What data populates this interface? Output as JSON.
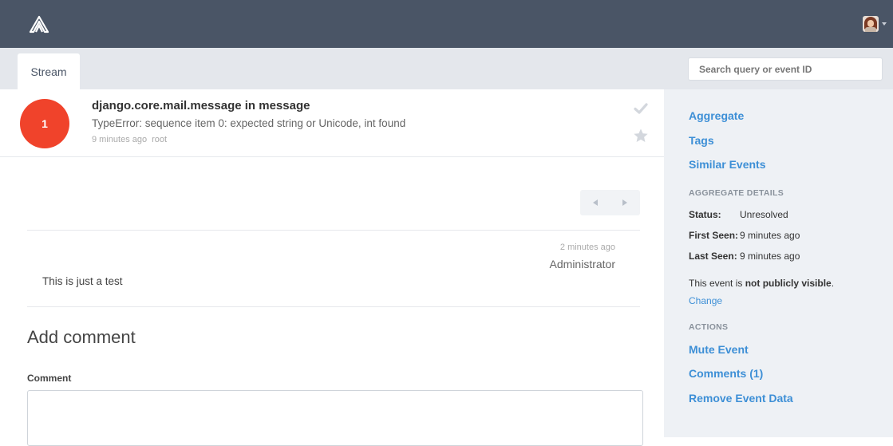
{
  "topbar": {
    "logo_icon": "sentry-logo-icon",
    "avatar_icon": "user-avatar-icon"
  },
  "tabs": [
    {
      "label": "Stream"
    }
  ],
  "search": {
    "placeholder": "Search query or event ID",
    "value": ""
  },
  "event": {
    "count": "1",
    "title": "django.core.mail.message in message",
    "message": "TypeError: sequence item 0: expected string or Unicode, int found",
    "time_ago": "9 minutes ago",
    "user": "root",
    "badge_color": "#f0432b"
  },
  "comment": {
    "time": "2 minutes ago",
    "author": "Administrator",
    "text": "This is just a test"
  },
  "add_comment": {
    "title": "Add comment",
    "field_label": "Comment",
    "field_value": ""
  },
  "sidebar": {
    "nav": [
      "Aggregate",
      "Tags",
      "Similar Events"
    ],
    "details_heading": "AGGREGATE DETAILS",
    "details": [
      {
        "key": "Status:",
        "value": "Unresolved"
      },
      {
        "key": "First Seen:",
        "value": "9 minutes ago"
      },
      {
        "key": "Last Seen:",
        "value": "9 minutes ago"
      }
    ],
    "visibility_prefix": "This event is ",
    "visibility_strong": "not publicly visible",
    "visibility_suffix": ".",
    "change_label": "Change",
    "actions_heading": "ACTIONS",
    "actions": [
      "Mute Event",
      "Comments (1)",
      "Remove Event Data"
    ]
  },
  "colors": {
    "topbar": "#4a5566",
    "link": "#3d8fd6",
    "sidebar_bg": "#eef1f5"
  }
}
